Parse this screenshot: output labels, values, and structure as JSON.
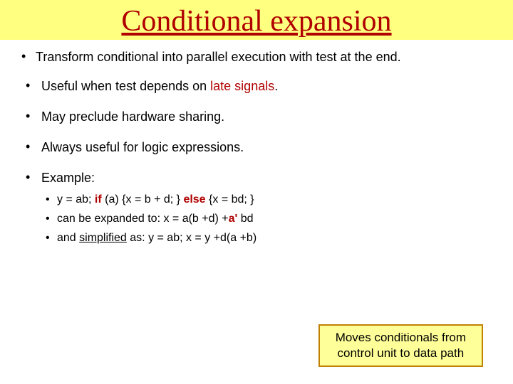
{
  "title": "Conditional expansion",
  "bullets": {
    "b1": "Transform conditional into parallel execution with test at the end.",
    "b2_pre": "Useful when test depends on ",
    "b2_late": "late signals",
    "b2_post": ".",
    "b3": "May preclude hardware sharing.",
    "b4": "Always useful for logic expressions.",
    "b5": "Example:"
  },
  "sub": {
    "s1_a": " y = ab; ",
    "s1_if": "if",
    "s1_b": " (a) {x = b + d; } ",
    "s1_else": "else",
    "s1_c": " {x = bd; }",
    "s2_a": " can be expanded to:      x = a(b +d) +",
    "s2_an": "a'",
    "s2_b": " bd",
    "s3_a": " and ",
    "s3_simp": "simplified",
    "s3_b": " as:     y = ab;     x = y +d(a +b)"
  },
  "callout": {
    "line1": "Moves conditionals from",
    "line2": "control unit to data path"
  }
}
